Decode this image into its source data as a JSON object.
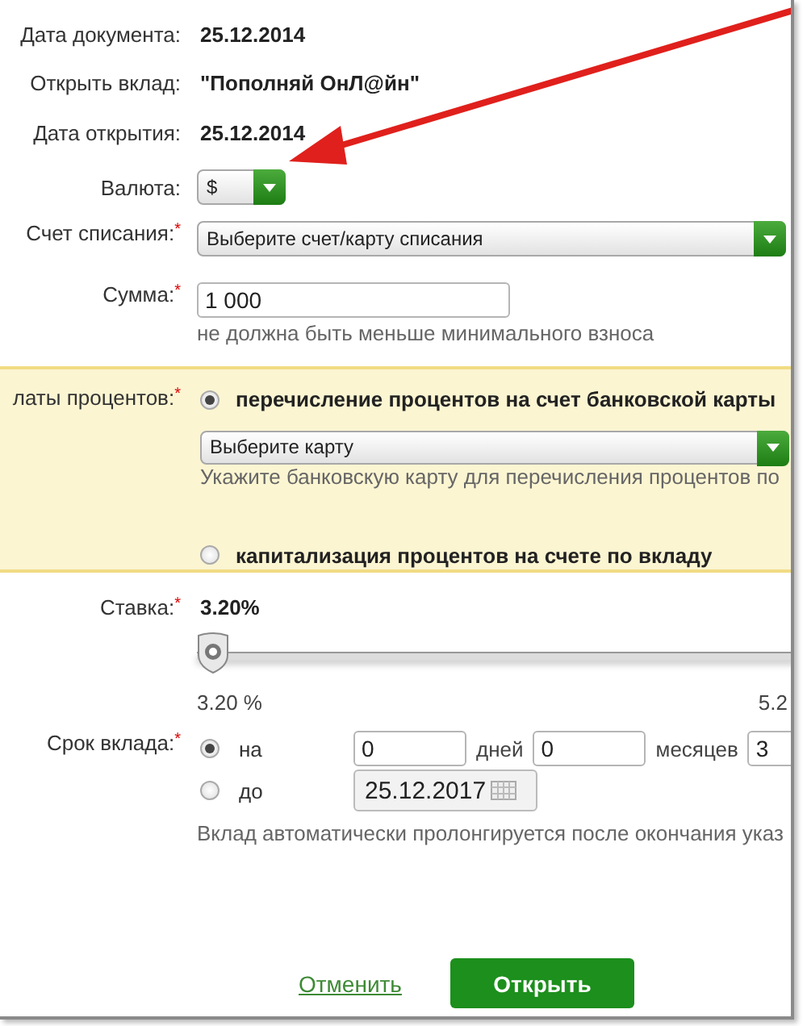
{
  "fields": [
    {
      "kind": "text",
      "label": "Дата документа:",
      "value": "25.12.2014"
    },
    {
      "kind": "text",
      "label": "Открыть вклад:",
      "value": "\"Пополняй ОнЛ@йн\""
    },
    {
      "kind": "text",
      "label": "Дата открытия:",
      "value": "25.12.2014"
    },
    {
      "kind": "compact",
      "label": "Валюта:",
      "value": "$"
    },
    {
      "kind": "select",
      "label": "Счет списания:",
      "required_mark": "*",
      "value": "Выберите счет/карту списания"
    },
    {
      "kind": "input",
      "label": "Сумма:",
      "required_mark": "*",
      "value": "1 000",
      "hint": "не должна быть меньше минимального взноса"
    }
  ],
  "interest_payout": {
    "label": "латы процентов:",
    "required_mark": "*",
    "options": [
      {
        "label": "перечисление процентов на счет банковской карты",
        "selected": true,
        "select": "Выберите карту",
        "hint": "Укажите банковскую карту для перечисления процентов по"
      },
      {
        "label": "капитализация процентов на счете по вкладу",
        "selected": false
      }
    ]
  },
  "rate": {
    "label": "Ставка:",
    "required_mark": "*",
    "value": "3.20%",
    "level": 0,
    "min_label": "3.20 %",
    "max_label": "5.2"
  },
  "term": {
    "label": "Срок вклада:",
    "required_mark": "*",
    "options": [
      {
        "kind": "duration",
        "label": "на",
        "selected": true,
        "inputs": [
          {
            "value": "0",
            "unit": "дней"
          },
          {
            "value": "0",
            "unit": "месяцев"
          },
          {
            "value": "3"
          }
        ]
      },
      {
        "kind": "date",
        "label": "до",
        "selected": false,
        "date": "25.12.2017"
      }
    ],
    "hint": "Вклад автоматически пролонгируется после окончания указ"
  },
  "actions": {
    "cancel": "Отменить",
    "submit": "Открыть"
  }
}
